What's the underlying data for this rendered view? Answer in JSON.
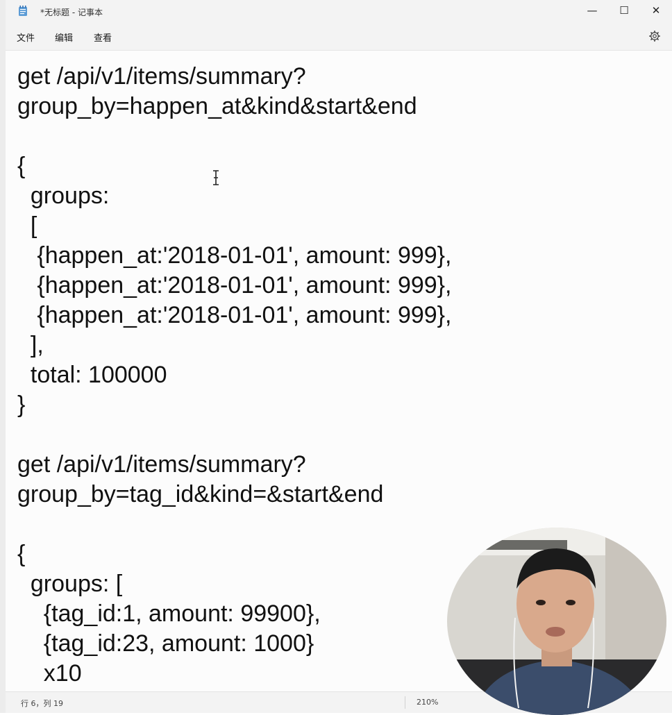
{
  "window": {
    "title": "*无标题 - 记事本",
    "minimize_glyph": "—",
    "maximize_glyph": "☐",
    "close_glyph": "✕"
  },
  "menu": {
    "file": "文件",
    "edit": "编辑",
    "view": "查看",
    "settings_icon": "gear-icon"
  },
  "editor": {
    "content": "get /api/v1/items/summary?\ngroup_by=happen_at&kind&start&end\n\n{\n  groups:\n  [\n   {happen_at:'2018-01-01', amount: 999},\n   {happen_at:'2018-01-01', amount: 999},\n   {happen_at:'2018-01-01', amount: 999},\n  ],\n  total: 100000\n}\n\nget /api/v1/items/summary?\ngroup_by=tag_id&kind=&start&end\n\n{\n  groups: [\n    {tag_id:1, amount: 99900},\n    {tag_id:23, amount: 1000}\n    x10"
  },
  "status": {
    "position": "行 6，列 19",
    "zoom": "210%"
  },
  "colors": {
    "chrome": "#f3f3f3",
    "editor_bg": "#fcfcfc",
    "text": "#111111",
    "icon_blue": "#2f6fb4"
  }
}
